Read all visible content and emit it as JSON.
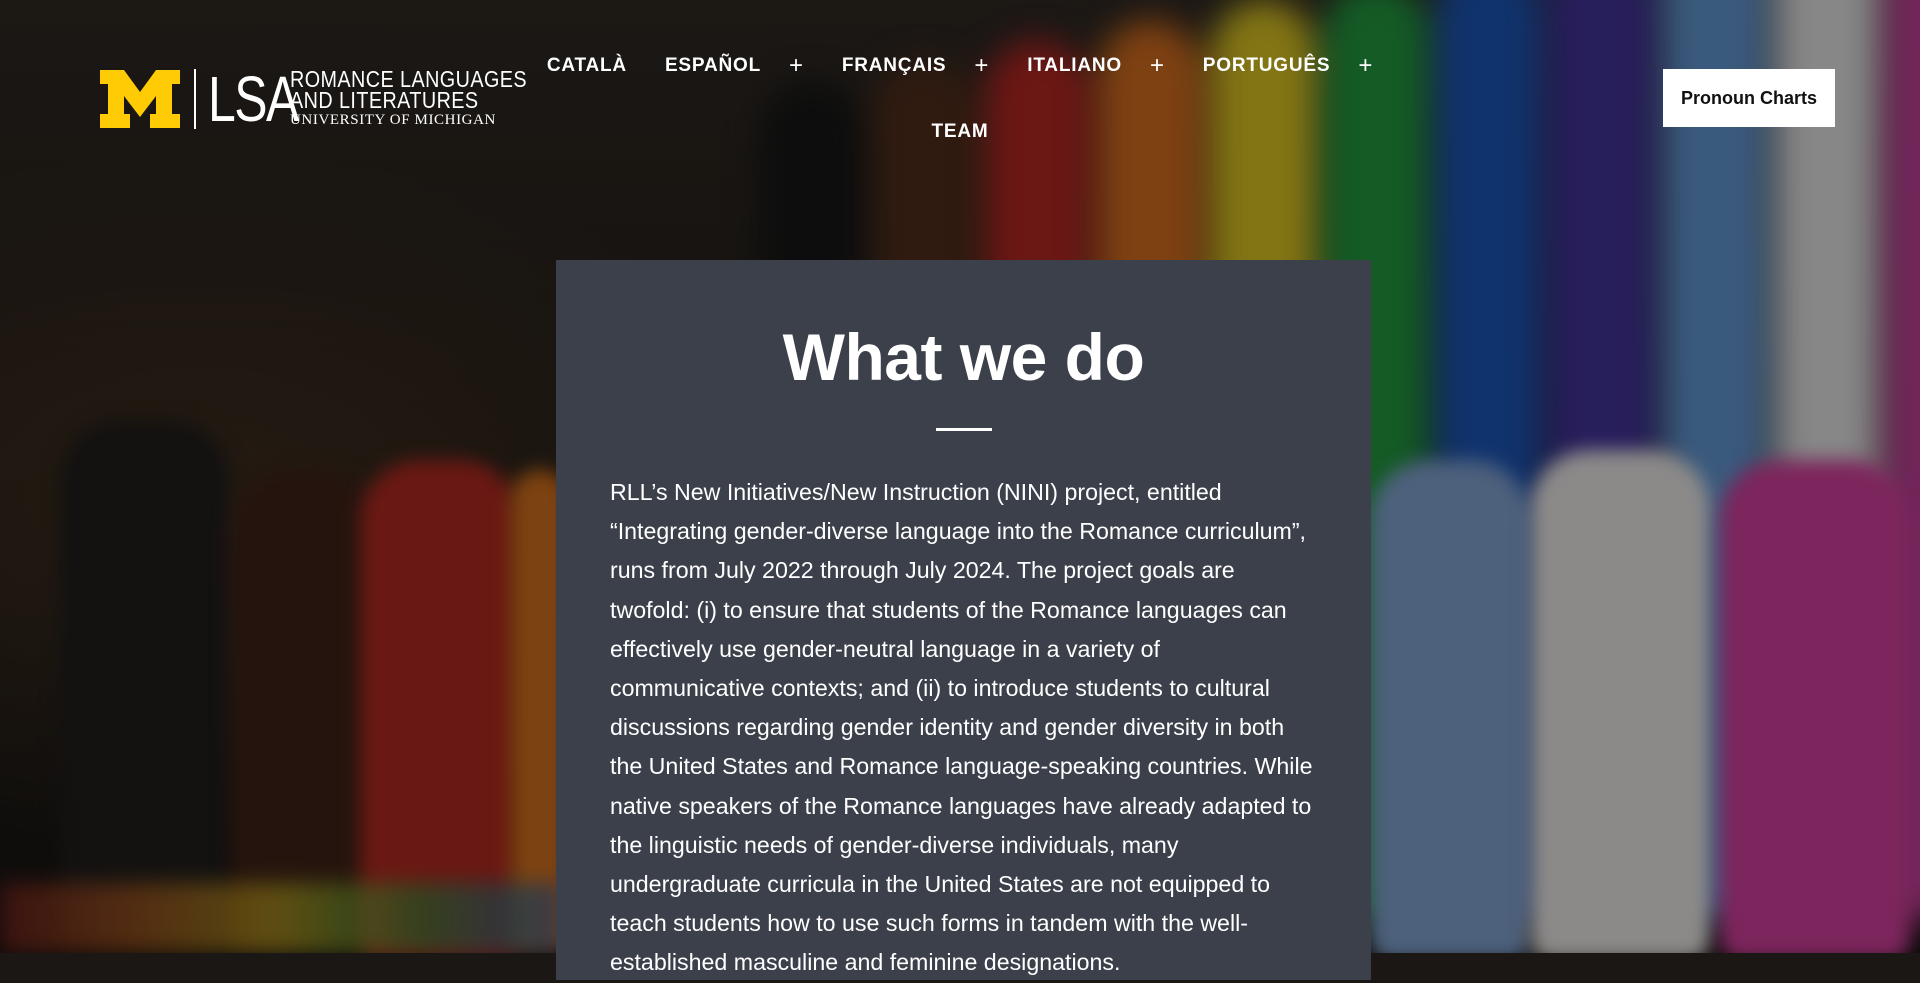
{
  "logo": {
    "block_m": "M",
    "lsa": "LSA",
    "line1": "ROMANCE LANGUAGES",
    "line2": "AND LITERATURES",
    "line3": "UNIVERSITY OF MICHIGAN",
    "brand_color": "#FFCB05"
  },
  "nav": {
    "items": [
      {
        "label": "CATALÀ",
        "expand": ""
      },
      {
        "label": "ESPAÑOL",
        "expand": "+"
      },
      {
        "label": "FRANÇAIS",
        "expand": "+"
      },
      {
        "label": "ITALIANO",
        "expand": "+"
      },
      {
        "label": "PORTUGUÊS",
        "expand": "+"
      },
      {
        "label": "TEAM",
        "expand": ""
      }
    ]
  },
  "header": {
    "cta_label": "Pronoun Charts"
  },
  "main": {
    "title": "What we do",
    "body": "RLL’s New Initiatives/New Instruction (NINI) project, entitled “Integrating gender-diverse language into the Romance curriculum”, runs from July 2022 through July 2024. The project goals are twofold: (i) to ensure that students of the Romance languages can effectively use gender-neutral language in a variety of communicative contexts; and (ii) to introduce students to cultural discussions regarding gender identity and gender diversity in both the United States and Romance language-speaking countries. While native speakers of the Romance languages have already adapted to the linguistic needs of gender-diverse individuals, many undergraduate curricula in the United States are not equipped to teach students how to use such forms in tandem with the well-established masculine and feminine designations.",
    "card_color": "#3B404B"
  }
}
